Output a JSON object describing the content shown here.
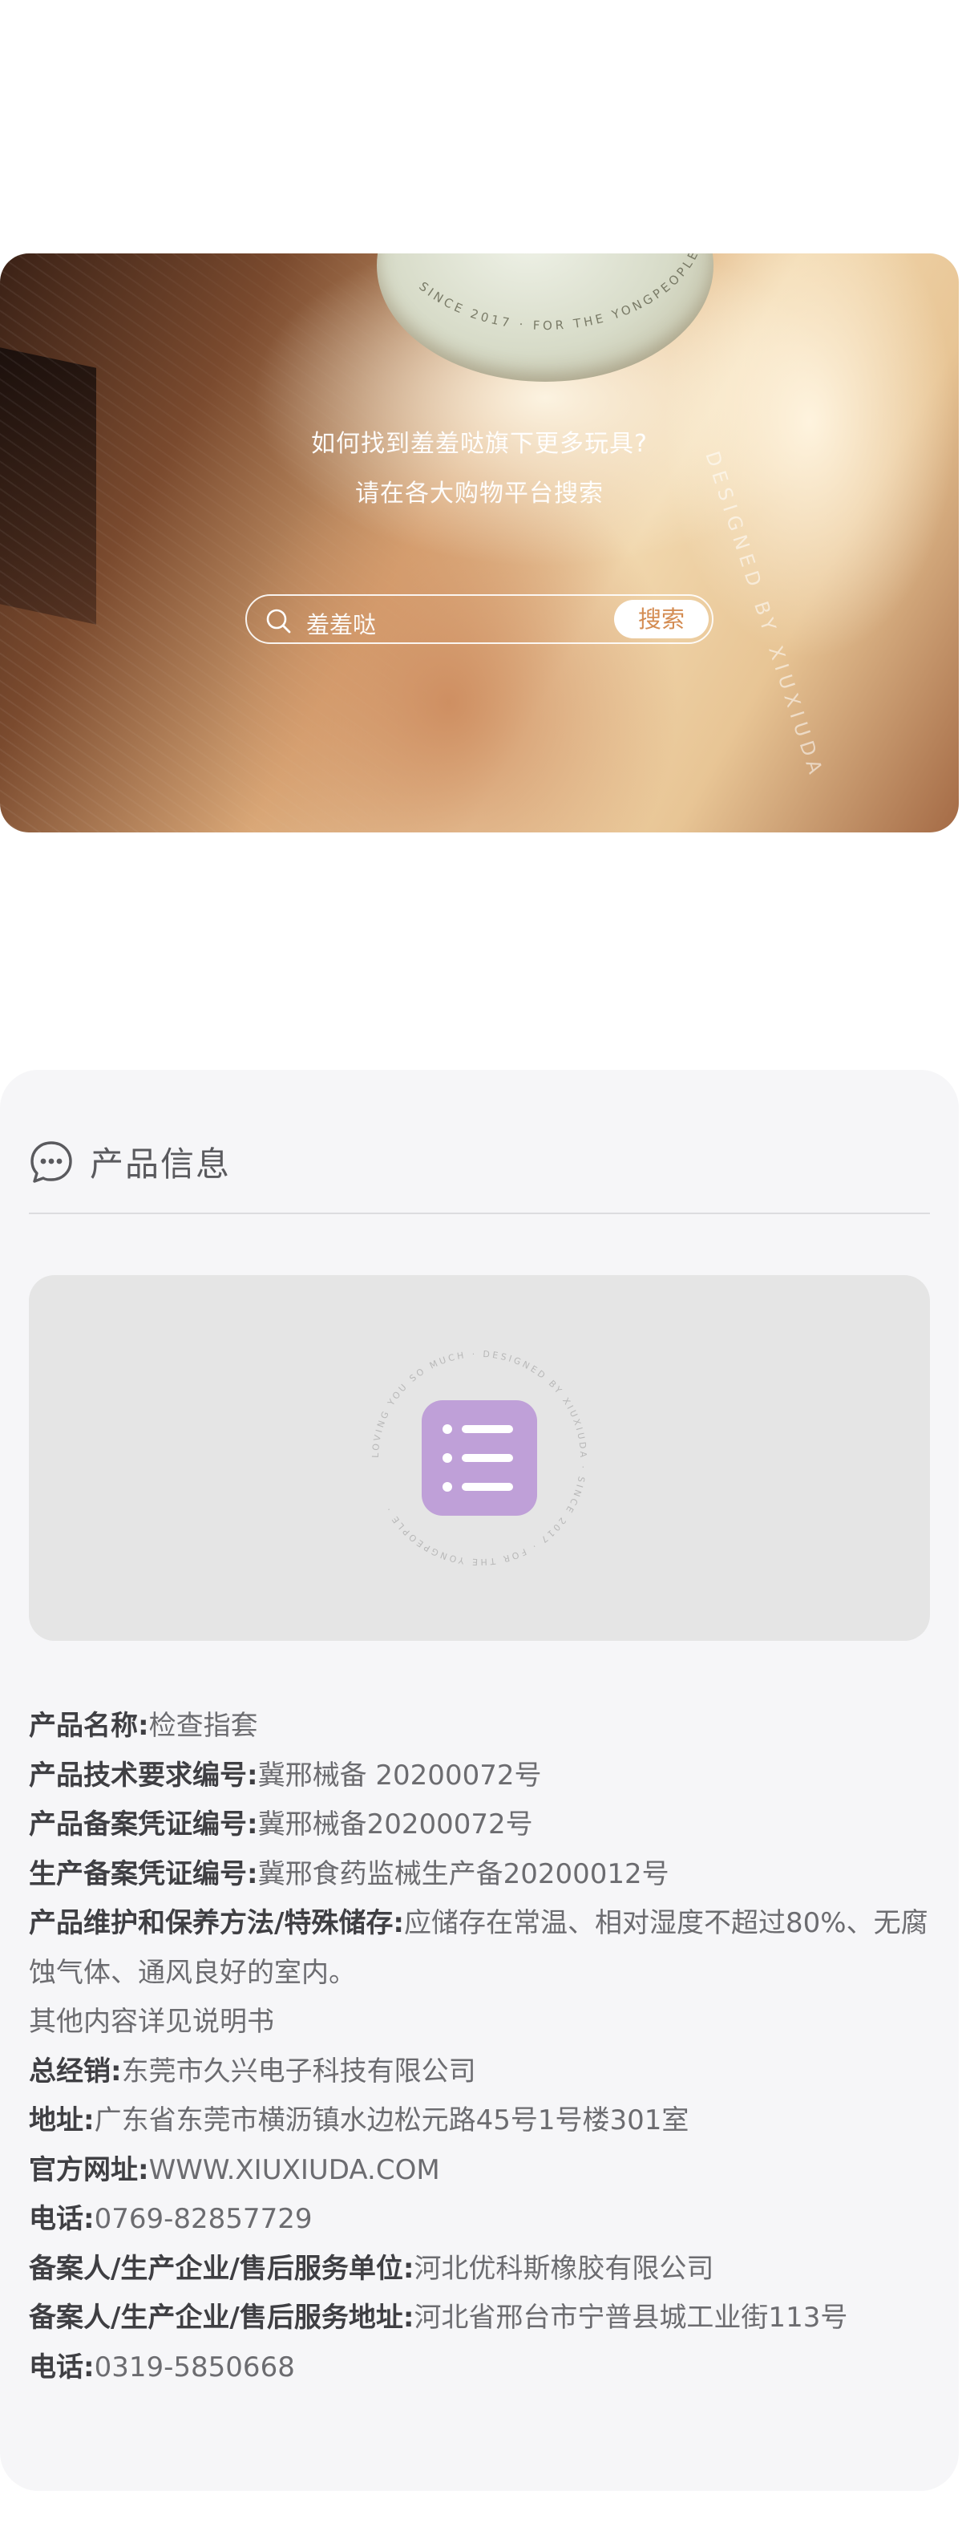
{
  "banner": {
    "line1": "如何找到羞羞哒旗下更多玩具?",
    "line2": "请在各大购物平台搜索",
    "product_engraving_top": "SINCE 2017 · FOR THE YONGPEOPLE",
    "product_engraving_side": "DESIGNED BY XIUXIUDA",
    "search": {
      "placeholder": "羞羞哒",
      "button_label": "搜索"
    }
  },
  "product_info": {
    "title": "产品信息",
    "image_placeholder": {
      "ring_text": "LOVING YOU SO MUCH · DESIGNED BY XIUXIUDA · SINCE 2017 · FOR THE YONGPEOPLE ·",
      "icon_color": "#bfa0d8"
    },
    "fields": [
      {
        "key": "产品名称:",
        "value": "检查指套"
      },
      {
        "key": "产品技术要求编号:",
        "value": "冀邢械备 20200072号"
      },
      {
        "key": "产品备案凭证编号:",
        "value": "冀邢械备20200072号"
      },
      {
        "key": "生产备案凭证编号:",
        "value": "冀邢食药监械生产备20200012号"
      },
      {
        "key": "产品维护和保养方法/特殊储存:",
        "value": "应储存在常温、相对湿度不超过80%、无腐蚀气体、通风良好的室内。"
      },
      {
        "key": "",
        "value": "其他内容详见说明书"
      },
      {
        "key": "总经销:",
        "value": "东莞市久兴电子科技有限公司"
      },
      {
        "key": "地址:",
        "value": "广东省东莞市横沥镇水边松元路45号1号楼301室"
      },
      {
        "key": "官方网址:",
        "value": "WWW.XIUXIUDA.COM"
      },
      {
        "key": "电话:",
        "value": "0769-82857729"
      },
      {
        "key": "备案人/生产企业/售后服务单位:",
        "value": "河北优科斯橡胶有限公司"
      },
      {
        "key": "备案人/生产企业/售后服务地址:",
        "value": "河北省邢台市宁普县城工业街113号"
      },
      {
        "key": "电话:",
        "value": "0319-5850668"
      }
    ]
  },
  "colors": {
    "accent": "#d48c52",
    "card_bg": "#f6f6f8",
    "image_bg": "#e5e5e5"
  }
}
